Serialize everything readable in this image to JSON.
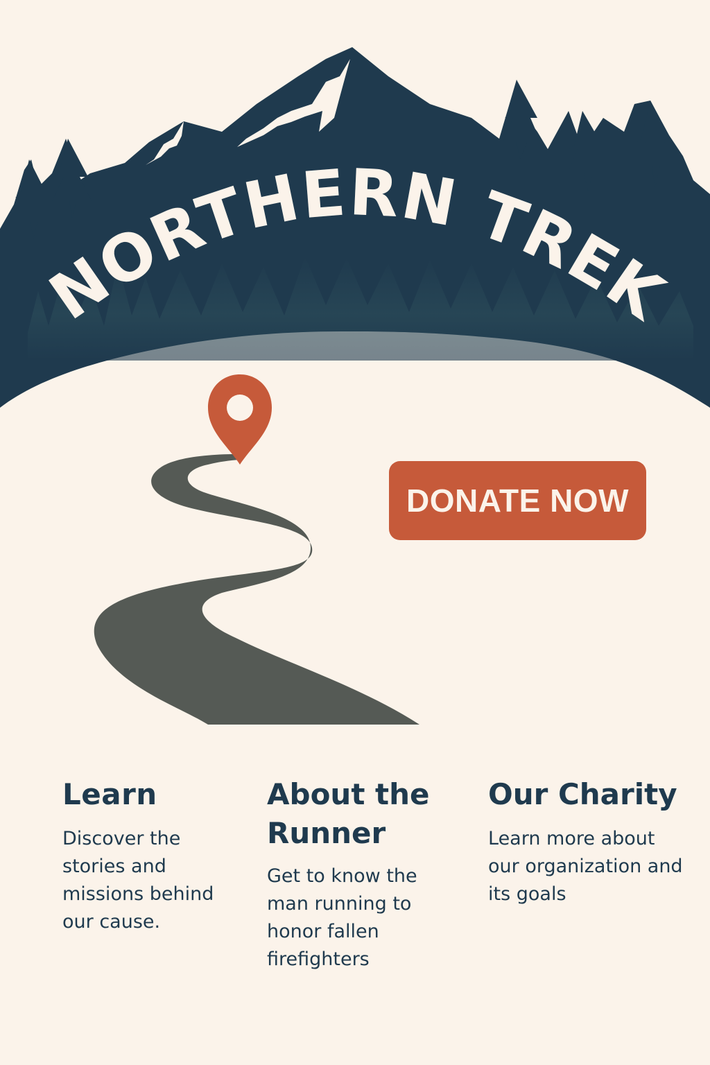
{
  "colors": {
    "background": "#fbf3ea",
    "navy": "#1f3a4e",
    "accent": "#c65a3a",
    "trail": "#555a55",
    "cream_text": "#fbf3ea"
  },
  "hero": {
    "title": "NORTHERN TREK"
  },
  "illustration": {
    "pin_icon": "map-pin-icon",
    "trail": "winding-trail"
  },
  "donate": {
    "label": "DONATE NOW"
  },
  "sections": [
    {
      "title": "Learn",
      "body": "Discover the stories and missions behind our cause."
    },
    {
      "title": "About the Runner",
      "body": "Get to know the man running to honor fallen firefighters"
    },
    {
      "title": "Our Charity",
      "body": "Learn more about our organization and its goals"
    }
  ]
}
